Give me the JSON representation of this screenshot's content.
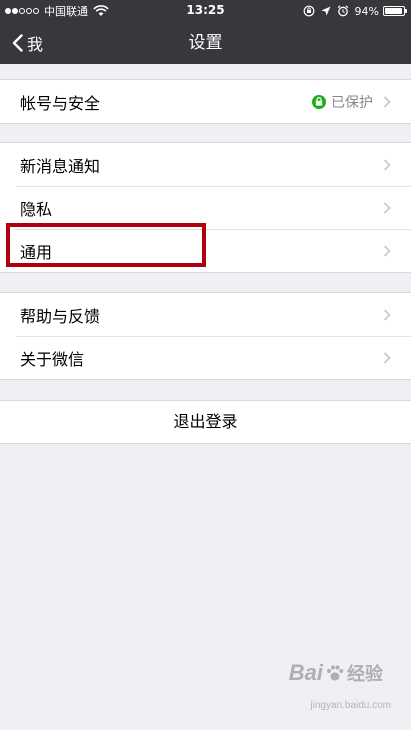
{
  "status_bar": {
    "carrier": "中国联通",
    "time": "13:25",
    "battery_percent_text": "94%",
    "battery_level": 0.94
  },
  "nav": {
    "back_label": "我",
    "title": "设置"
  },
  "groups": [
    {
      "items": [
        {
          "label": "帐号与安全",
          "value": "已保护"
        }
      ]
    },
    {
      "items": [
        {
          "label": "新消息通知"
        },
        {
          "label": "隐私"
        },
        {
          "label": "通用"
        }
      ]
    },
    {
      "items": [
        {
          "label": "帮助与反馈"
        },
        {
          "label": "关于微信"
        }
      ]
    }
  ],
  "logout_label": "退出登录",
  "colors": {
    "nav_background": "#38373c",
    "page_background": "#efeff4",
    "lock_badge": "#1aad19",
    "highlight_box": "#b00010"
  },
  "watermark": {
    "brand": "Bai",
    "brand_suffix": "经验",
    "url": "jingyan.baidu.com"
  }
}
